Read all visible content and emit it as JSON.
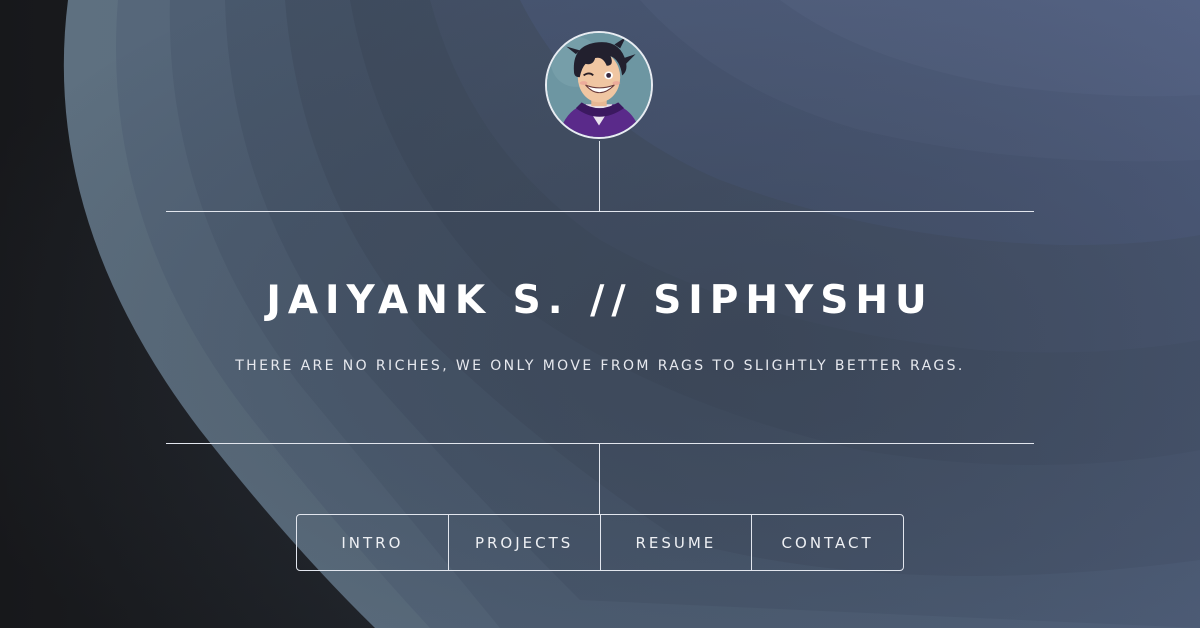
{
  "header": {
    "name": "JAIYANK S. // SIPHYSHU",
    "tagline": "THERE ARE NO RICHES, WE ONLY MOVE FROM RAGS TO SLIGHTLY BETTER RAGS."
  },
  "nav": {
    "items": [
      {
        "label": "INTRO"
      },
      {
        "label": "PROJECTS"
      },
      {
        "label": "RESUME"
      },
      {
        "label": "CONTACT"
      }
    ]
  },
  "colors": {
    "dark_corner": "#17181b",
    "background_light": "#5c6d80",
    "background_mid": "#3b4656",
    "background_accent": "#515f7e",
    "lines": "#e2e6ee"
  },
  "avatar": {
    "icon": "avatar-character-icon"
  }
}
